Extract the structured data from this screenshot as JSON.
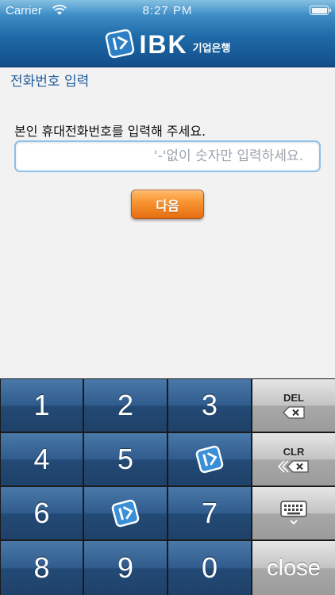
{
  "status_bar": {
    "carrier": "Carrier",
    "time": "8:27 PM"
  },
  "header": {
    "brand": "IBK",
    "brand_sub": "기업은행"
  },
  "page": {
    "title": "전화번호 입력",
    "instruction": "본인 휴대전화번호를 입력해 주세요.",
    "phone_placeholder": "'-'없이 숫자만 입력하세요.",
    "phone_value": "",
    "next_label": "다음"
  },
  "keypad": {
    "digits": [
      "1",
      "2",
      "3",
      "4",
      "5",
      "6",
      "7",
      "8",
      "9",
      "0"
    ],
    "del_label": "DEL",
    "clr_label": "CLR",
    "close_label": "close"
  },
  "colors": {
    "header_blue": "#1f6aa8",
    "title_blue": "#1f5d9a",
    "button_orange": "#f7922f",
    "key_blue": "#2f5c8d",
    "key_gray": "#b5b5b5"
  }
}
